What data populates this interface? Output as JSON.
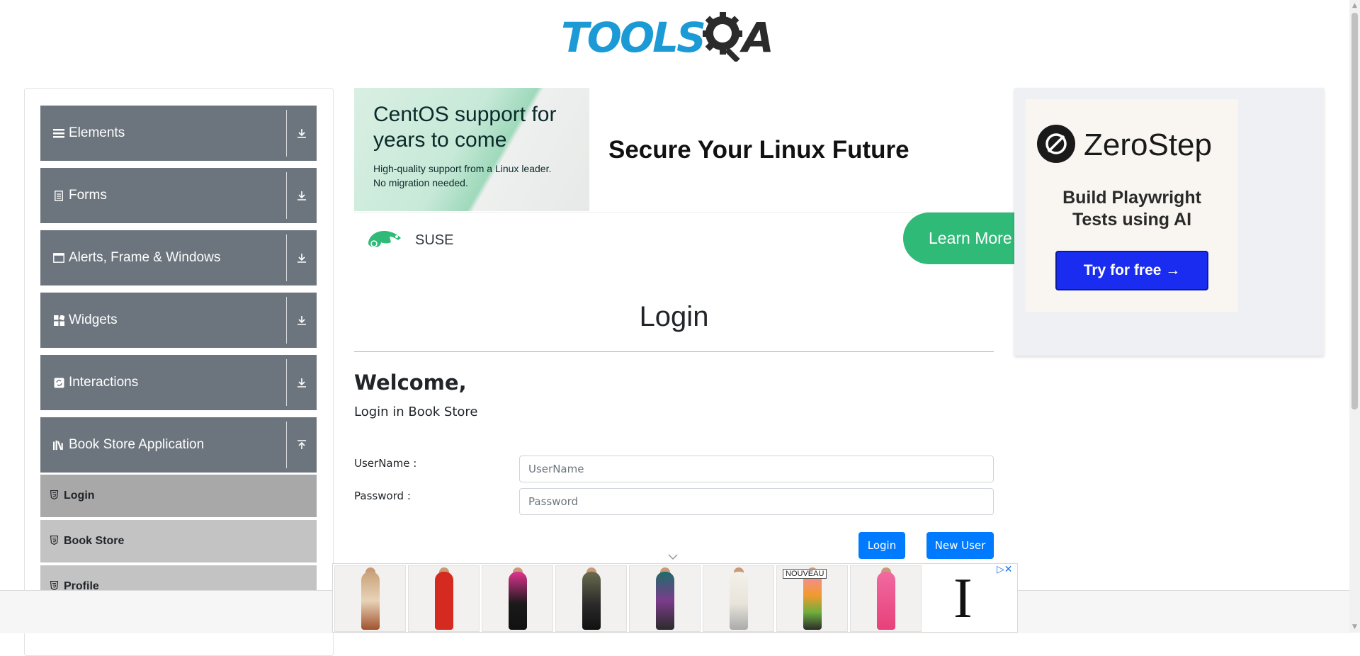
{
  "logo": {
    "part1": "TOOLS",
    "part2": "A"
  },
  "sidebar": {
    "groups": [
      {
        "label": "Elements",
        "icon": "menu-icon",
        "arrow": "download-icon"
      },
      {
        "label": "Forms",
        "icon": "document-icon",
        "arrow": "download-icon"
      },
      {
        "label": "Alerts, Frame & Windows",
        "icon": "window-icon",
        "arrow": "download-icon"
      },
      {
        "label": "Widgets",
        "icon": "grid-icon",
        "arrow": "download-icon"
      },
      {
        "label": "Interactions",
        "icon": "refresh-icon",
        "arrow": "download-icon"
      },
      {
        "label": "Book Store Application",
        "icon": "books-icon",
        "arrow": "upload-icon"
      }
    ],
    "sub_items": [
      {
        "label": "Login",
        "active": true
      },
      {
        "label": "Book Store",
        "active": false
      },
      {
        "label": "Profile",
        "active": false
      }
    ]
  },
  "ad_top": {
    "image_heading": "CentOS support for years to come",
    "image_sub_line1": "High-quality support from a Linux leader.",
    "image_sub_line2": "No migration needed.",
    "headline": "Secure Your Linux Future",
    "brand": "SUSE",
    "cta": "Learn More"
  },
  "ad_right": {
    "brand": "ZeroStep",
    "tagline_line1": "Build Playwright",
    "tagline_line2": "Tests using AI",
    "button": "Try for free →"
  },
  "main": {
    "title": "Login",
    "welcome": "Welcome,",
    "subtitle": "Login in Book Store",
    "username_label": "UserName :",
    "username_placeholder": "UserName",
    "password_label": "Password :",
    "password_placeholder": "Password",
    "login_button": "Login",
    "new_user_button": "New User"
  },
  "bottom_ad": {
    "badge": "NOUVEAU",
    "brand_letter": "I",
    "ad_choices": "▷✕"
  }
}
